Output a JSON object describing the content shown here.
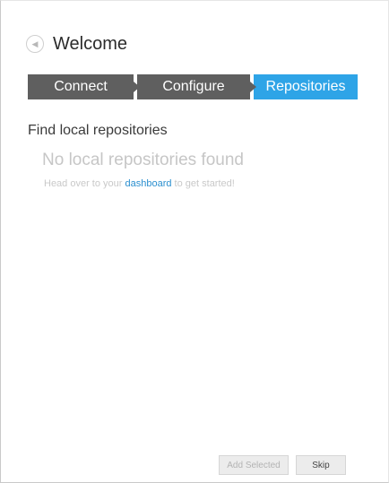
{
  "header": {
    "back_icon": "chevron-left-icon",
    "title": "Welcome"
  },
  "steps": [
    {
      "label": "Connect",
      "state": "done"
    },
    {
      "label": "Configure",
      "state": "done"
    },
    {
      "label": "Repositories",
      "state": "active"
    }
  ],
  "colors": {
    "step_done": "#5f5f5f",
    "step_active": "#2ea4e7",
    "link": "#2b8fcf"
  },
  "main": {
    "section_title": "Find local repositories",
    "empty_title": "No local repositories found",
    "empty_prefix": "Head over to your ",
    "empty_link": "dashboard",
    "empty_suffix": " to get started!"
  },
  "footer": {
    "add_selected_label": "Add Selected",
    "skip_label": "Skip"
  }
}
